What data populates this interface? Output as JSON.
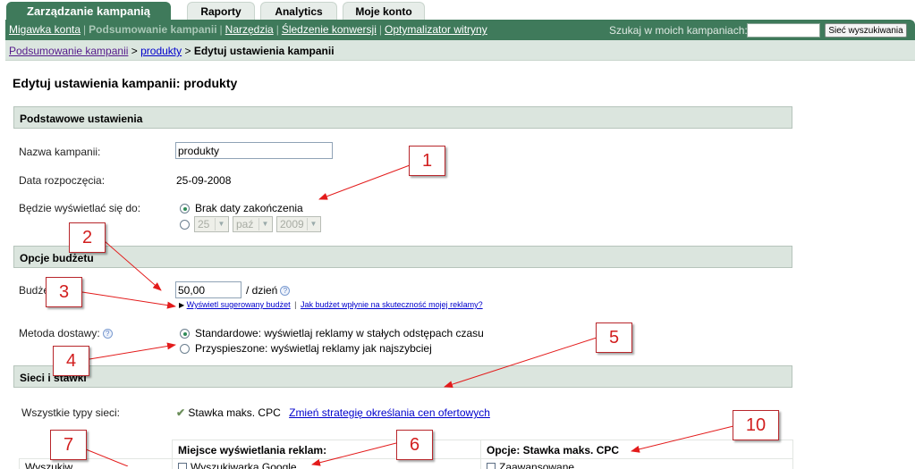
{
  "tabs": [
    {
      "label": "Zarządzanie kampanią",
      "active": true
    },
    {
      "label": "Raporty",
      "active": false
    },
    {
      "label": "Analytics",
      "active": false
    },
    {
      "label": "Moje konto",
      "active": false
    }
  ],
  "subnav": {
    "items": [
      {
        "label": "Migawka konta",
        "current": false
      },
      {
        "label": "Podsumowanie kampanii",
        "current": true
      },
      {
        "label": "Narzędzia",
        "current": false
      },
      {
        "label": "Śledzenie konwersji",
        "current": false
      },
      {
        "label": "Optymalizator witryny",
        "current": false
      }
    ],
    "separator": "|"
  },
  "search": {
    "label": "Szukaj w moich kampaniach:",
    "value": "",
    "button_label": "Sieć wyszukiwania"
  },
  "breadcrumb": {
    "items": [
      "Podsumowanie kampanii",
      "produkty"
    ],
    "current": "Edytuj ustawienia kampanii",
    "separator": ">"
  },
  "page_title": "Edytuj ustawienia kampanii: produkty",
  "basic_settings": {
    "header": "Podstawowe ustawienia",
    "campaign_name_label": "Nazwa kampanii:",
    "campaign_name_value": "produkty",
    "start_date_label": "Data rozpoczęcia:",
    "start_date_value": "25-09-2008",
    "end_label": "Będzie wyświetlać się do:",
    "no_end_option": "Brak daty zakończenia",
    "no_end_selected": true,
    "end_day": "25",
    "end_month": "paź",
    "end_year": "2009"
  },
  "budget": {
    "header": "Opcje budżetu",
    "label": "Budżet:",
    "value": "50,00",
    "unit": "/ dzień",
    "help_icon": "?",
    "suggest_link": "Wyświetl sugerowany budżet",
    "impact_link": "Jak budżet wpłynie na skuteczność mojej reklamy?",
    "delivery_label": "Metoda dostawy:",
    "delivery_options": [
      {
        "label": "Standardowe: wyświetlaj reklamy w stałych odstępach czasu",
        "selected": true
      },
      {
        "label": "Przyspieszone: wyświetlaj reklamy jak najszybciej",
        "selected": false
      }
    ]
  },
  "networks": {
    "header": "Sieci i stawki",
    "all_networks_label": "Wszystkie typy sieci:",
    "bid_strategy": "Stawka maks. CPC",
    "change_strategy_link": "Zmień strategię określania cen ofertowych",
    "col_placement": "Miejsce wyświetlania reklam:",
    "col_options": "Opcje: Stawka maks. CPC",
    "row_label_partial": "Wyszukiw...",
    "row_placement_partial": "Wyszukiwarka Google",
    "row_option_partial": "Zaawansowane..."
  },
  "callouts": [
    "1",
    "2",
    "3",
    "4",
    "5",
    "6",
    "7",
    "10"
  ],
  "colors": {
    "brand_green": "#3f7a5b",
    "section_bg": "#dbe5de",
    "callout_red": "#d21e1e",
    "link_blue": "#0000cc"
  }
}
